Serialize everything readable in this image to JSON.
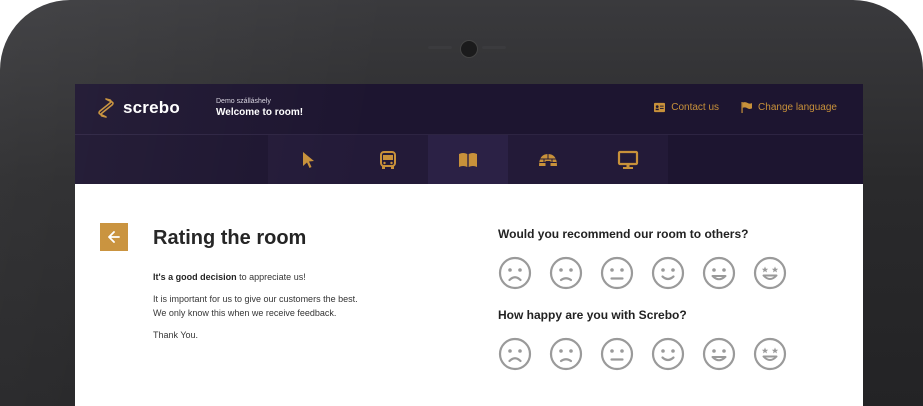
{
  "header": {
    "logo_text": "screbo",
    "hotel_name": "Demo szálláshely",
    "welcome": "Welcome to room!",
    "contact_label": "Contact us",
    "language_label": "Change language"
  },
  "nav": {
    "items": [
      {
        "icon": "cursor-icon"
      },
      {
        "icon": "bus-icon"
      },
      {
        "icon": "book-icon"
      },
      {
        "icon": "igloo-icon"
      },
      {
        "icon": "monitor-icon"
      }
    ]
  },
  "page": {
    "title": "Rating the room",
    "lead_bold": "It's a good decision",
    "lead_rest": " to appreciate us!",
    "line1": "It is important for us to give our customers the best.",
    "line2": "We only know this when we receive feedback.",
    "thanks": "Thank You."
  },
  "questions": [
    {
      "text": "Would you recommend our room to others?"
    },
    {
      "text": "How happy are you with Screbo?"
    }
  ],
  "ratings": [
    "very-dissatisfied",
    "dissatisfied",
    "neutral",
    "satisfied",
    "very-satisfied",
    "excellent"
  ],
  "colors": {
    "accent": "#c8913a",
    "header_bg": "#1d1530",
    "face_gray": "#9a9a9a"
  }
}
